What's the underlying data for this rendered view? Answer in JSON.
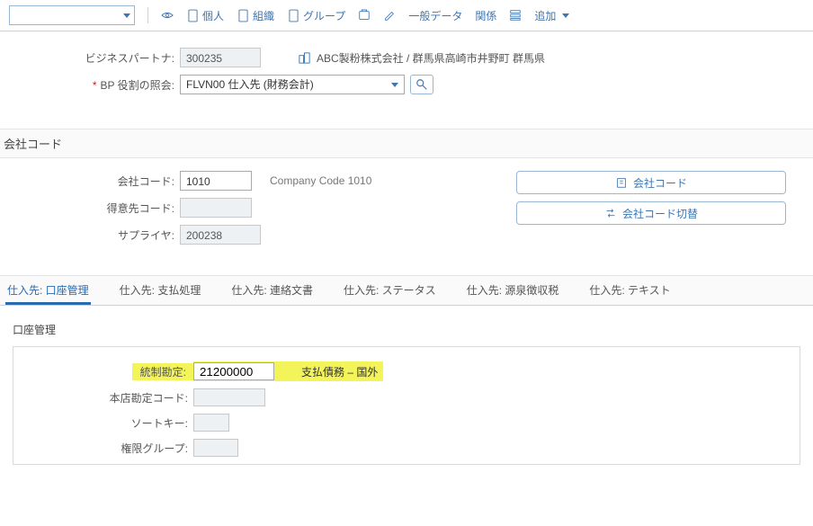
{
  "toolbar": {
    "items": [
      {
        "label": "個人"
      },
      {
        "label": "組織"
      },
      {
        "label": "グループ"
      },
      {
        "label": "一般データ"
      },
      {
        "label": "関係"
      },
      {
        "label": "追加"
      }
    ]
  },
  "header": {
    "bp_label": "ビジネスパートナ:",
    "bp_value": "300235",
    "role_label": "BP 役割の照会:",
    "role_value": "FLVN00 仕入先 (財務会計)",
    "breadcrumb": "ABC製粉株式会社 / 群馬県高崎市井野町 群馬県"
  },
  "company_section": {
    "title": "会社コード",
    "company_code_label": "会社コード:",
    "company_code_value": "1010",
    "company_code_desc": "Company Code 1010",
    "customer_label": "得意先コード:",
    "supplier_label": "サプライヤ:",
    "supplier_value": "200238",
    "btn_company": "会社コード",
    "btn_switch": "会社コード切替"
  },
  "tabs": [
    {
      "label": "仕入先: 口座管理",
      "active": true
    },
    {
      "label": "仕入先: 支払処理"
    },
    {
      "label": "仕入先: 連絡文書"
    },
    {
      "label": "仕入先: ステータス"
    },
    {
      "label": "仕入先: 源泉徴収税"
    },
    {
      "label": "仕入先: テキスト"
    }
  ],
  "detail": {
    "title": "口座管理",
    "recon_label": "統制勘定:",
    "recon_value": "21200000",
    "recon_desc": "支払債務 – 国外",
    "head_office_label": "本店勘定コード:",
    "sort_key_label": "ソートキー:",
    "auth_group_label": "権限グループ:"
  }
}
